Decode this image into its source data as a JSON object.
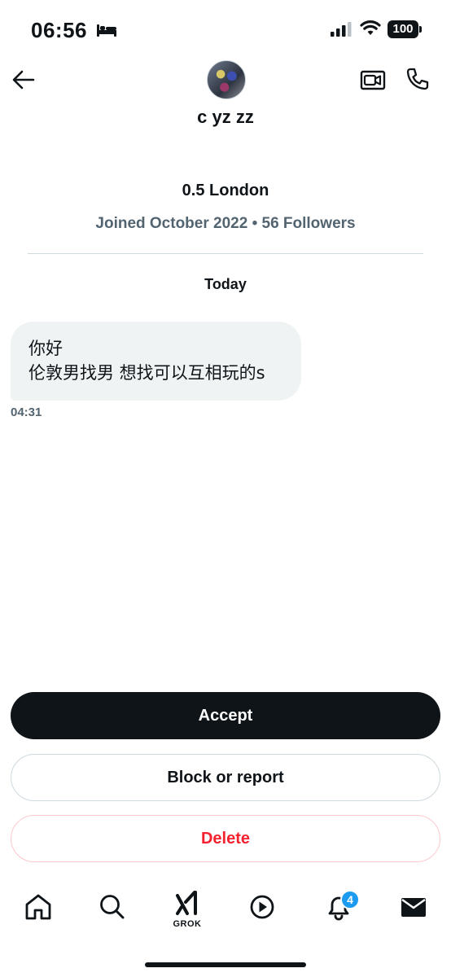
{
  "status_bar": {
    "time": "06:56",
    "battery": "100"
  },
  "header": {
    "contact_name": "c yz zz"
  },
  "profile": {
    "display_line": "0.5 London",
    "meta": "Joined October 2022 • 56 Followers"
  },
  "conversation": {
    "day_label": "Today",
    "messages": [
      {
        "lines": [
          "你好",
          "伦敦男找男 想找可以互相玩的s"
        ],
        "time": "04:31"
      }
    ]
  },
  "actions": {
    "accept_label": "Accept",
    "block_label": "Block or report",
    "delete_label": "Delete"
  },
  "nav": {
    "grok_label": "GROK",
    "notifications_badge": "4",
    "items": [
      "home-icon",
      "search-icon",
      "grok-icon",
      "play-icon",
      "bell-icon",
      "mail-icon"
    ]
  },
  "colors": {
    "text": "#0f1419",
    "secondary": "#536471",
    "bubble": "#eff3f4",
    "delete": "#f4212e",
    "badge": "#1d9bf0"
  }
}
